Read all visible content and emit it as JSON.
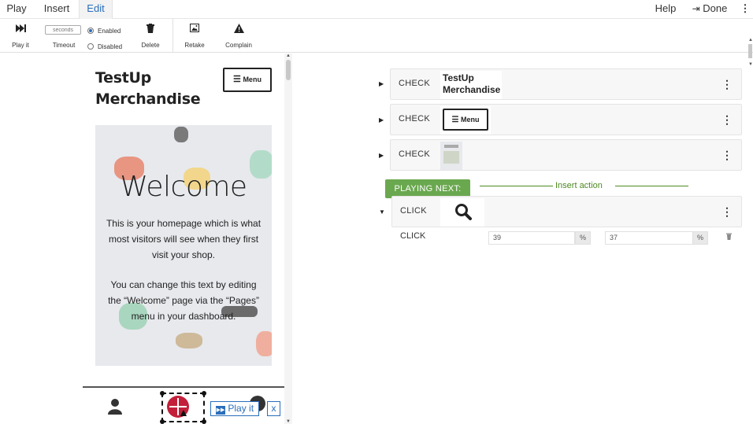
{
  "menubar": {
    "play": "Play",
    "insert": "Insert",
    "edit": "Edit",
    "help": "Help",
    "done": "Done",
    "more": "⋮"
  },
  "toolbar": {
    "play_it": "Play it",
    "timeout": "Timeout",
    "seconds_placeholder": "seconds",
    "enabled": "Enabled",
    "disabled": "Disabled",
    "enabled_selected": true,
    "delete": "Delete",
    "retake": "Retake",
    "complain": "Complain"
  },
  "preview": {
    "site_title": "TestUp Merchandise",
    "menu_button": "Menu",
    "welcome": "Welcome",
    "paragraph1": "This is your homepage which is what most visitors will see when they first visit your shop.",
    "paragraph2": "You can change this text by editing the “Welcome” page via the “Pages” menu in your dashboard.",
    "play_it_overlay": "Play it",
    "close_overlay": "x"
  },
  "actions": {
    "rows": [
      {
        "verb": "CHECK",
        "thumb_text": "TestUp Merchandise"
      },
      {
        "verb": "CHECK",
        "thumb_text": "Menu"
      },
      {
        "verb": "CHECK",
        "thumb_text": ""
      },
      {
        "verb": "CLICK",
        "thumb_text": ""
      }
    ],
    "insert_action": "Insert action",
    "playing_next": "PLAYING NEXT:",
    "detail": {
      "verb": "CLICK",
      "x_value": "39",
      "x_unit": "%",
      "y_value": "37",
      "y_unit": "%"
    }
  },
  "colors": {
    "accent": "#2a6ebb",
    "playing_next": "#6aa84f",
    "insert_line": "#4d8a22",
    "click_target": "#c2203a"
  }
}
